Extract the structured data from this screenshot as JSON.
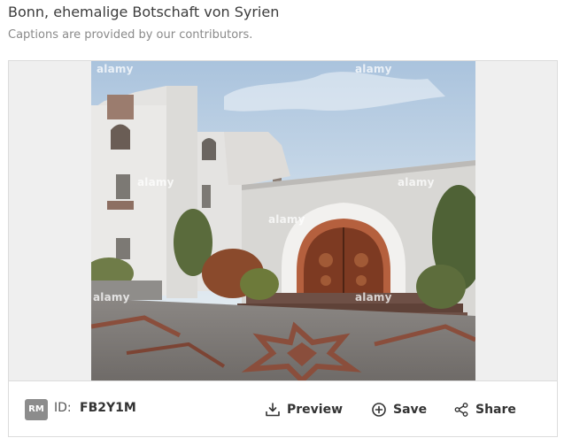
{
  "header": {
    "title": "Bonn, ehemalige Botschaft von Syrien",
    "caption_note": "Captions are provided by our contributors."
  },
  "image": {
    "watermark": "alamy"
  },
  "footer": {
    "license_badge": "RM",
    "id_label": "ID:",
    "id_value": "FB2Y1M",
    "actions": {
      "preview": "Preview",
      "save": "Save",
      "share": "Share"
    }
  },
  "icons": {
    "preview": "download-tray-icon",
    "save": "plus-circle-icon",
    "share": "share-nodes-icon"
  }
}
